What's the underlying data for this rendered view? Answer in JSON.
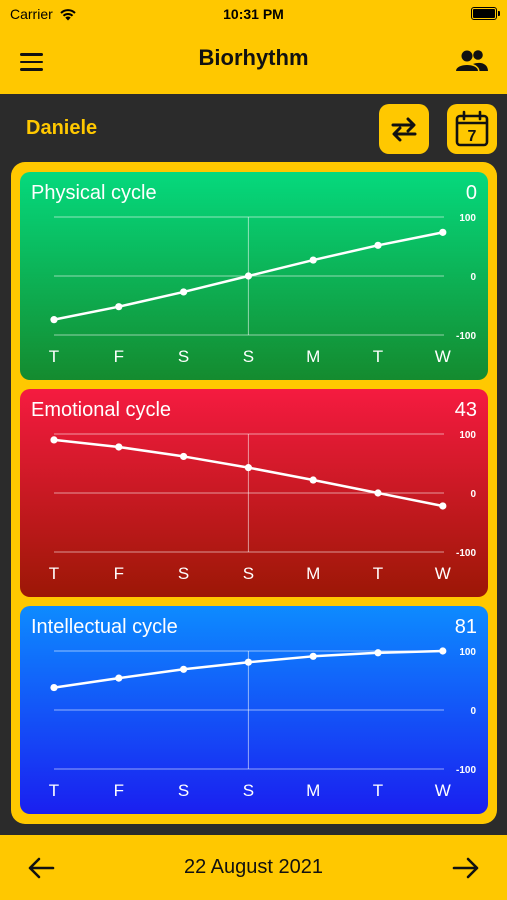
{
  "status": {
    "carrier": "Carrier",
    "time": "10:31 PM",
    "battery_level": 1.0
  },
  "nav": {
    "title": "Biorhythm",
    "menu_icon": "hamburger-icon",
    "users_icon": "users-icon"
  },
  "person": {
    "name": "Daniele"
  },
  "toolbar": {
    "swap_icon": "swap-arrows-icon",
    "calendar_icon": "calendar-icon",
    "calendar_day": "7"
  },
  "cycles": [
    {
      "title": "Physical cycle",
      "value": "0",
      "colors": [
        "#05d97d",
        "#148b2f"
      ]
    },
    {
      "title": "Emotional cycle",
      "value": "43",
      "colors": [
        "#f51b40",
        "#9c1706"
      ]
    },
    {
      "title": "Intellectual cycle",
      "value": "81",
      "colors": [
        "#0d8bff",
        "#1a1ff0"
      ]
    }
  ],
  "footer": {
    "date": "22 August 2021",
    "prev_icon": "arrow-left-icon",
    "next_icon": "arrow-right-icon"
  },
  "chart_data": [
    {
      "type": "line",
      "title": "Physical cycle",
      "categories": [
        "T",
        "F",
        "S",
        "S",
        "M",
        "T",
        "W"
      ],
      "values": [
        -74,
        -52,
        -27,
        0,
        27,
        52,
        74
      ],
      "ylim": [
        -100,
        100
      ],
      "ytick_labels": [
        "100",
        "0",
        "-100"
      ],
      "grid": true
    },
    {
      "type": "line",
      "title": "Emotional cycle",
      "categories": [
        "T",
        "F",
        "S",
        "S",
        "M",
        "T",
        "W"
      ],
      "values": [
        90,
        78,
        62,
        43,
        22,
        0,
        -22
      ],
      "ylim": [
        -100,
        100
      ],
      "ytick_labels": [
        "100",
        "0",
        "-100"
      ],
      "grid": true
    },
    {
      "type": "line",
      "title": "Intellectual cycle",
      "categories": [
        "T",
        "F",
        "S",
        "S",
        "M",
        "T",
        "W"
      ],
      "values": [
        38,
        54,
        69,
        81,
        91,
        97,
        100
      ],
      "ylim": [
        -100,
        100
      ],
      "ytick_labels": [
        "100",
        "0",
        "-100"
      ],
      "grid": true
    }
  ]
}
